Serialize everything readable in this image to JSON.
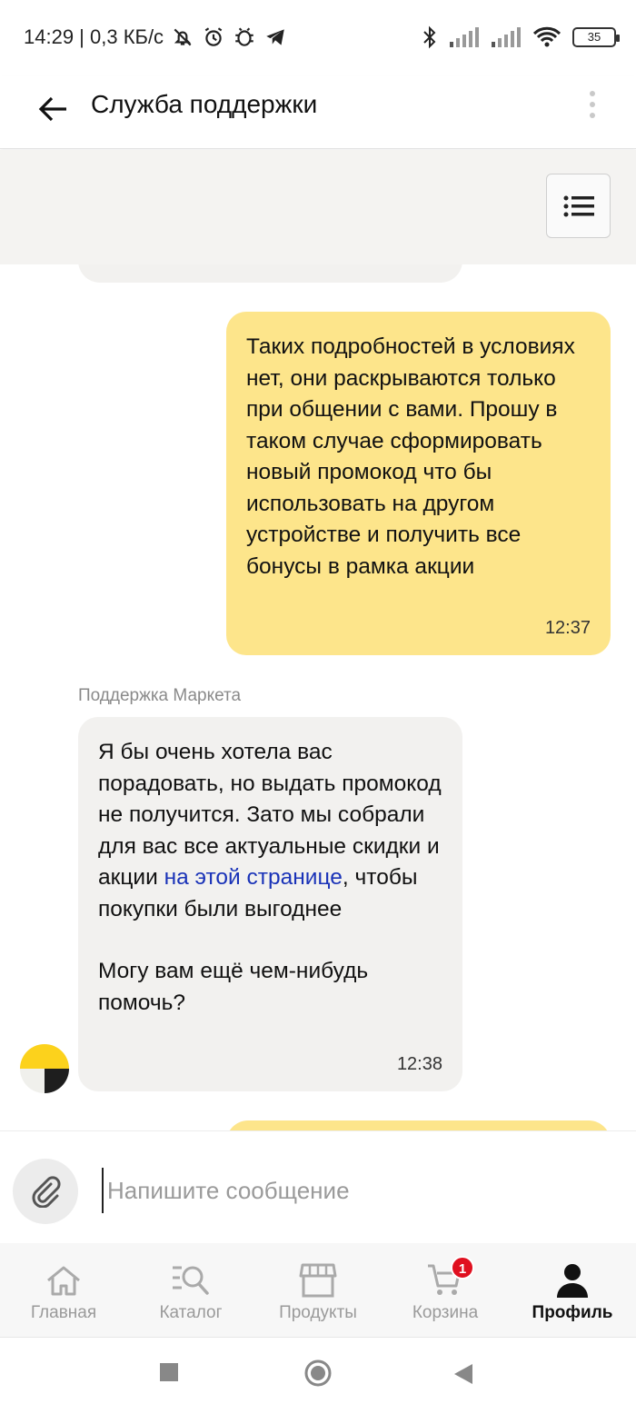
{
  "status_bar": {
    "left_text": "14:29 | 0,3 КБ/с",
    "battery": "35"
  },
  "header": {
    "title": "Служба поддержки"
  },
  "messages": {
    "outgoing_1": {
      "text": "Таких подробностей в условиях нет, они раскрываются только при общении с вами. Прошу в таком случае сформировать новый промокод что бы использовать на другом устройстве и получить все бонусы в рамка акции",
      "time": "12:37"
    },
    "incoming_1": {
      "sender": "Поддержка Маркета",
      "text_before_link": "Я бы очень хотела вас порадовать, но выдать промокод не получится. Зато мы собрали для вас все актуальные скидки и акции ",
      "link_text": "на этой странице",
      "text_after_link": ", чтобы покупки были выгоднее",
      "text_2": "Могу вам ещё чем-нибудь помочь?",
      "time": "12:38"
    }
  },
  "composer": {
    "placeholder": "Напишите сообщение"
  },
  "bottom_nav": {
    "items": [
      {
        "label": "Главная",
        "icon": "home-icon"
      },
      {
        "label": "Каталог",
        "icon": "catalog-search-icon"
      },
      {
        "label": "Продукты",
        "icon": "store-icon"
      },
      {
        "label": "Корзина",
        "icon": "cart-icon",
        "badge": "1"
      },
      {
        "label": "Профиль",
        "icon": "profile-icon",
        "active": true
      }
    ]
  },
  "colors": {
    "outgoing_bubble": "#fde58b",
    "incoming_bubble": "#f2f1ef",
    "link": "#1a33b8",
    "badge": "#e01020"
  }
}
